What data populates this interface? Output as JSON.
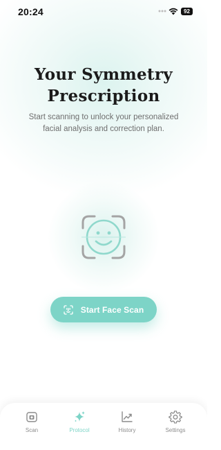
{
  "status_bar": {
    "time": "20:24",
    "battery": "92"
  },
  "main": {
    "title_line1": "Your Symmetry",
    "title_line2": "Prescription",
    "subtitle": "Start scanning to unlock your personalized facial analysis and correction plan.",
    "face_icon": "face-scan-icon",
    "scan_button_label": "Start Face Scan",
    "scan_button_icon": "face-id-icon"
  },
  "tab_bar": {
    "active_tab": "Protocol",
    "tabs": [
      {
        "label": "Scan",
        "icon": "camera-icon"
      },
      {
        "label": "Protocol",
        "icon": "sparkle-icon"
      },
      {
        "label": "History",
        "icon": "chart-icon"
      },
      {
        "label": "Settings",
        "icon": "gear-icon"
      }
    ]
  },
  "colors": {
    "accent": "#7dd4c7",
    "title": "#1b1b1b",
    "subtitle": "#6e6e6e",
    "inactive_tab": "#8c8c8c",
    "icon_gray": "#9a9a9a"
  }
}
